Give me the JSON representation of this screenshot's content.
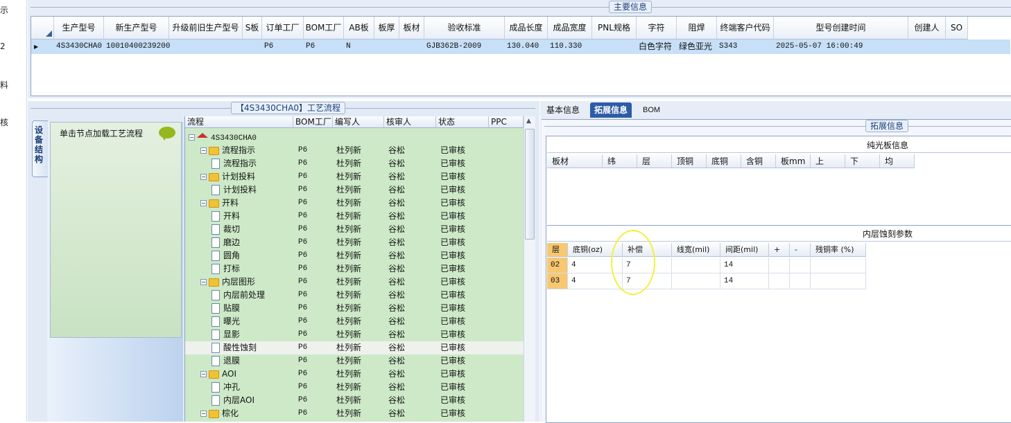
{
  "left_nav": {
    "items": [
      "示",
      "2",
      "料",
      "核"
    ]
  },
  "main_info": {
    "title": "主要信息",
    "columns": [
      "生产型号",
      "新生产型号",
      "升级前旧生产型号",
      "S板",
      "订单工厂",
      "BOM工厂",
      "AB板",
      "板厚",
      "板材",
      "验收标准",
      "成品长度",
      "成品宽度",
      "PNL规格",
      "字符",
      "阻焊",
      "终端客户代码",
      "型号创建时间",
      "创建人",
      "SO"
    ],
    "row": [
      "4S3430CHA0",
      "10010400239200",
      "",
      "",
      "P6",
      "P6",
      "N",
      "",
      "",
      "GJB362B-2009",
      "130.040",
      "110.330",
      "",
      "白色字符",
      "绿色亚光",
      "S343",
      "2025-05-07 16:00:49",
      "",
      ""
    ]
  },
  "process": {
    "title": "【4S3430CHA0】工艺流程",
    "side_tab": "设备结构",
    "node_hint": "单击节点加载工艺流程",
    "columns": [
      "流程",
      "BOM工厂",
      "编写人",
      "核审人",
      "状态",
      "PPC"
    ],
    "root": "4S3430CHA0",
    "rows": [
      {
        "name": "流程指示",
        "type": "folder",
        "level": 1,
        "bom": "P6",
        "writer": "杜列新",
        "reviewer": "谷松",
        "status": "已审核"
      },
      {
        "name": "流程指示",
        "type": "doc",
        "level": 2,
        "bom": "P6",
        "writer": "杜列新",
        "reviewer": "谷松",
        "status": "已审核"
      },
      {
        "name": "计划投料",
        "type": "folder",
        "level": 1,
        "bom": "P6",
        "writer": "杜列新",
        "reviewer": "谷松",
        "status": "已审核"
      },
      {
        "name": "计划投料",
        "type": "doc",
        "level": 2,
        "bom": "P6",
        "writer": "杜列新",
        "reviewer": "谷松",
        "status": "已审核"
      },
      {
        "name": "开料",
        "type": "folder",
        "level": 1,
        "bom": "P6",
        "writer": "杜列新",
        "reviewer": "谷松",
        "status": "已审核"
      },
      {
        "name": "开料",
        "type": "doc",
        "level": 2,
        "bom": "P6",
        "writer": "杜列新",
        "reviewer": "谷松",
        "status": "已审核"
      },
      {
        "name": "裁切",
        "type": "doc",
        "level": 2,
        "bom": "P6",
        "writer": "杜列新",
        "reviewer": "谷松",
        "status": "已审核"
      },
      {
        "name": "磨边",
        "type": "doc",
        "level": 2,
        "bom": "P6",
        "writer": "杜列新",
        "reviewer": "谷松",
        "status": "已审核"
      },
      {
        "name": "圆角",
        "type": "doc",
        "level": 2,
        "bom": "P6",
        "writer": "杜列新",
        "reviewer": "谷松",
        "status": "已审核"
      },
      {
        "name": "打标",
        "type": "doc",
        "level": 2,
        "bom": "P6",
        "writer": "杜列新",
        "reviewer": "谷松",
        "status": "已审核"
      },
      {
        "name": "内层图形",
        "type": "folder",
        "level": 1,
        "bom": "P6",
        "writer": "杜列新",
        "reviewer": "谷松",
        "status": "已审核"
      },
      {
        "name": "内层前处理",
        "type": "doc",
        "level": 2,
        "bom": "P6",
        "writer": "杜列新",
        "reviewer": "谷松",
        "status": "已审核"
      },
      {
        "name": "贴膜",
        "type": "doc",
        "level": 2,
        "bom": "P6",
        "writer": "杜列新",
        "reviewer": "谷松",
        "status": "已审核"
      },
      {
        "name": "曝光",
        "type": "doc",
        "level": 2,
        "bom": "P6",
        "writer": "杜列新",
        "reviewer": "谷松",
        "status": "已审核"
      },
      {
        "name": "显影",
        "type": "doc",
        "level": 2,
        "bom": "P6",
        "writer": "杜列新",
        "reviewer": "谷松",
        "status": "已审核"
      },
      {
        "name": "酸性蚀刻",
        "type": "doc",
        "level": 2,
        "bom": "P6",
        "writer": "杜列新",
        "reviewer": "谷松",
        "status": "已审核",
        "selected": true
      },
      {
        "name": "退膜",
        "type": "doc",
        "level": 2,
        "bom": "P6",
        "writer": "杜列新",
        "reviewer": "谷松",
        "status": "已审核"
      },
      {
        "name": "AOI",
        "type": "folder",
        "level": 1,
        "bom": "P6",
        "writer": "杜列新",
        "reviewer": "谷松",
        "status": "已审核"
      },
      {
        "name": "冲孔",
        "type": "doc",
        "level": 2,
        "bom": "P6",
        "writer": "杜列新",
        "reviewer": "谷松",
        "status": "已审核"
      },
      {
        "name": "内层AOI",
        "type": "doc",
        "level": 2,
        "bom": "P6",
        "writer": "杜列新",
        "reviewer": "谷松",
        "status": "已审核"
      },
      {
        "name": "棕化",
        "type": "folder",
        "level": 1,
        "bom": "P6",
        "writer": "杜列新",
        "reviewer": "谷松",
        "status": "已审核"
      }
    ]
  },
  "right_panel": {
    "tabs": [
      "基本信息",
      "拓展信息",
      "BOM"
    ],
    "active_tab": "拓展信息",
    "group_title": "拓展信息",
    "plain_board": {
      "title": "纯光板信息",
      "columns": [
        "板材",
        "纬",
        "层",
        "顶铜",
        "底铜",
        "含铜",
        "板mm",
        "上",
        "下",
        "均"
      ]
    },
    "inner_etch": {
      "title": "内层蚀刻参数",
      "columns": [
        "层",
        "底铜(oz)",
        "补偿",
        "线宽(mil)",
        "间距(mil)",
        "+",
        "-",
        "残铜率 (%)"
      ],
      "rows": [
        [
          "02",
          "4",
          "7",
          "",
          "14",
          "",
          "",
          ""
        ],
        [
          "03",
          "4",
          "7",
          "",
          "14",
          "",
          "",
          ""
        ]
      ]
    }
  },
  "colors": {
    "tree_bg": "#cde9c8",
    "selected_row": "#c7dff7",
    "highlight_ellipse": "#f3f13a",
    "active_tab": "#2d5ca6"
  }
}
